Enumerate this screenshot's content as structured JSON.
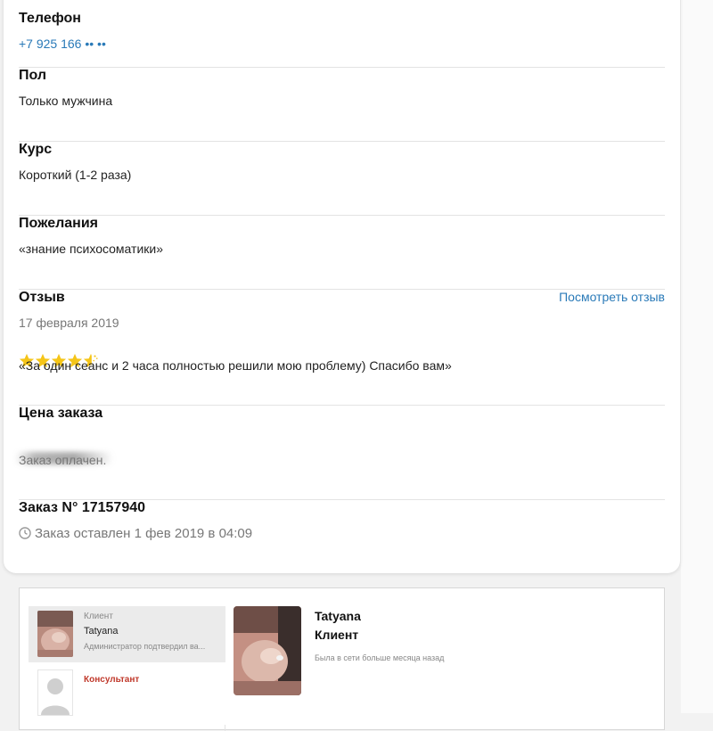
{
  "details": {
    "phone": {
      "title": "Телефон",
      "value": "+7 925 166 •• ••"
    },
    "gender": {
      "title": "Пол",
      "value": "Только мужчина"
    },
    "course": {
      "title": "Курс",
      "value": "Короткий (1-2 раза)"
    },
    "wishes": {
      "title": "Пожелания",
      "value": "«знание психосоматики»"
    },
    "review": {
      "title": "Отзыв",
      "link": "Посмотреть отзыв",
      "date": "17 февраля 2019",
      "rating": 4.5,
      "text": "«За один сеанс и 2 часа полностью решили мою проблему) Спасибо вам»"
    },
    "price": {
      "title": "Цена заказа",
      "status": "Заказ оплачен."
    },
    "order": {
      "title": "Заказ N° 17157940",
      "created": "Заказ оставлен 1 фев 2019 в 04:09"
    }
  },
  "chat": {
    "items": [
      {
        "role": "Клиент",
        "name": "Tatyana",
        "preview": "Администратор подтвердил ва..."
      },
      {
        "role": "Консультант"
      }
    ],
    "profile": {
      "name": "Tatyana",
      "role": "Клиент",
      "status": "Была в сети больше месяца назад"
    }
  },
  "colors": {
    "accent": "#2a7ab8",
    "star": "#f5c518",
    "consultant": "#c0392b"
  }
}
